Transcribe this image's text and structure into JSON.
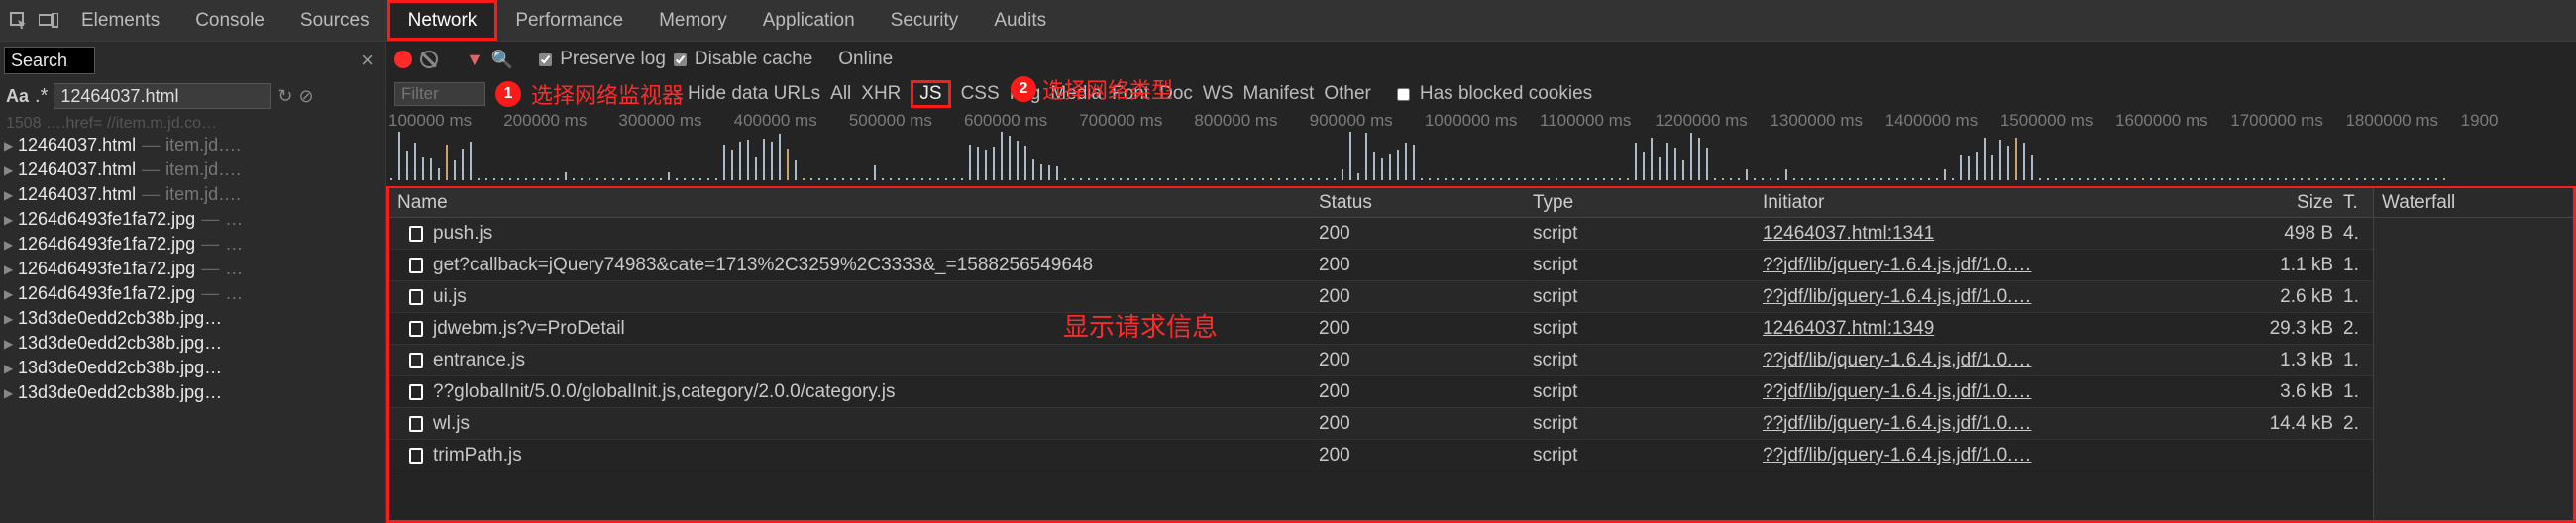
{
  "tabs": {
    "elements": "Elements",
    "console": "Console",
    "sources": "Sources",
    "network": "Network",
    "performance": "Performance",
    "memory": "Memory",
    "application": "Application",
    "security": "Security",
    "audits": "Audits"
  },
  "left": {
    "search_value": "Search",
    "filter_value": "12464037.html",
    "head_row": "1508 ….href= //item.m.jd.co…",
    "items": [
      {
        "name": "12464037.html",
        "host": "item.jd…."
      },
      {
        "name": "12464037.html",
        "host": "item.jd…."
      },
      {
        "name": "12464037.html",
        "host": "item.jd…."
      },
      {
        "name": "1264d6493fe1fa72.jpg",
        "host": "…"
      },
      {
        "name": "1264d6493fe1fa72.jpg",
        "host": "…"
      },
      {
        "name": "1264d6493fe1fa72.jpg",
        "host": "…"
      },
      {
        "name": "1264d6493fe1fa72.jpg",
        "host": "…"
      },
      {
        "name": "13d3de0edd2cb38b.jpg…",
        "host": ""
      },
      {
        "name": "13d3de0edd2cb38b.jpg…",
        "host": ""
      },
      {
        "name": "13d3de0edd2cb38b.jpg…",
        "host": ""
      },
      {
        "name": "13d3de0edd2cb38b.jpg…",
        "host": ""
      }
    ]
  },
  "toolbar1": {
    "preserve_log": "Preserve log",
    "disable_cache": "Disable cache",
    "online": "Online"
  },
  "annotations": {
    "a1_num": "1",
    "a1_text": "选择网络监视器",
    "a2_num": "2",
    "a2_text": "选择网络类型",
    "center": "显示请求信息"
  },
  "toolbar2": {
    "filter_placeholder": "Filter",
    "hide_data_urls": "Hide data URLs",
    "chips": {
      "all": "All",
      "xhr": "XHR",
      "js": "JS",
      "css": "CSS",
      "img": "Img",
      "media": "Media",
      "font": "Font",
      "doc": "Doc",
      "ws": "WS",
      "manifest": "Manifest",
      "other": "Other"
    },
    "has_blocked": "Has blocked cookies"
  },
  "timeline": [
    "100000 ms",
    "200000 ms",
    "300000 ms",
    "400000 ms",
    "500000 ms",
    "600000 ms",
    "700000 ms",
    "800000 ms",
    "900000 ms",
    "1000000 ms",
    "1100000 ms",
    "1200000 ms",
    "1300000 ms",
    "1400000 ms",
    "1500000 ms",
    "1600000 ms",
    "1700000 ms",
    "1800000 ms",
    "1900"
  ],
  "net": {
    "headers": {
      "name": "Name",
      "status": "Status",
      "type": "Type",
      "initiator": "Initiator",
      "size": "Size",
      "time": "T.",
      "waterfall": "Waterfall"
    },
    "rows": [
      {
        "name": "push.js",
        "status": "200",
        "type": "script",
        "initiator": "12464037.html:1341",
        "size": "498 B",
        "time": "4."
      },
      {
        "name": "get?callback=jQuery74983&cate=1713%2C3259%2C3333&_=1588256549648",
        "status": "200",
        "type": "script",
        "initiator": "??jdf/lib/jquery-1.6.4.js,jdf/1.0.…",
        "size": "1.1 kB",
        "time": "1."
      },
      {
        "name": "ui.js",
        "status": "200",
        "type": "script",
        "initiator": "??jdf/lib/jquery-1.6.4.js,jdf/1.0.…",
        "size": "2.6 kB",
        "time": "1."
      },
      {
        "name": "jdwebm.js?v=ProDetail",
        "status": "200",
        "type": "script",
        "initiator": "12464037.html:1349",
        "size": "29.3 kB",
        "time": "2."
      },
      {
        "name": "entrance.js",
        "status": "200",
        "type": "script",
        "initiator": "??jdf/lib/jquery-1.6.4.js,jdf/1.0.…",
        "size": "1.3 kB",
        "time": "1."
      },
      {
        "name": "??globalInit/5.0.0/globalInit.js,category/2.0.0/category.js",
        "status": "200",
        "type": "script",
        "initiator": "??jdf/lib/jquery-1.6.4.js,jdf/1.0.…",
        "size": "3.6 kB",
        "time": "1."
      },
      {
        "name": "wl.js",
        "status": "200",
        "type": "script",
        "initiator": "??jdf/lib/jquery-1.6.4.js,jdf/1.0.…",
        "size": "14.4 kB",
        "time": "2."
      },
      {
        "name": "trimPath.js",
        "status": "200",
        "type": "script",
        "initiator": "??jdf/lib/jquery-1.6.4.js,jdf/1.0.…",
        "size": "",
        "time": ""
      }
    ]
  }
}
